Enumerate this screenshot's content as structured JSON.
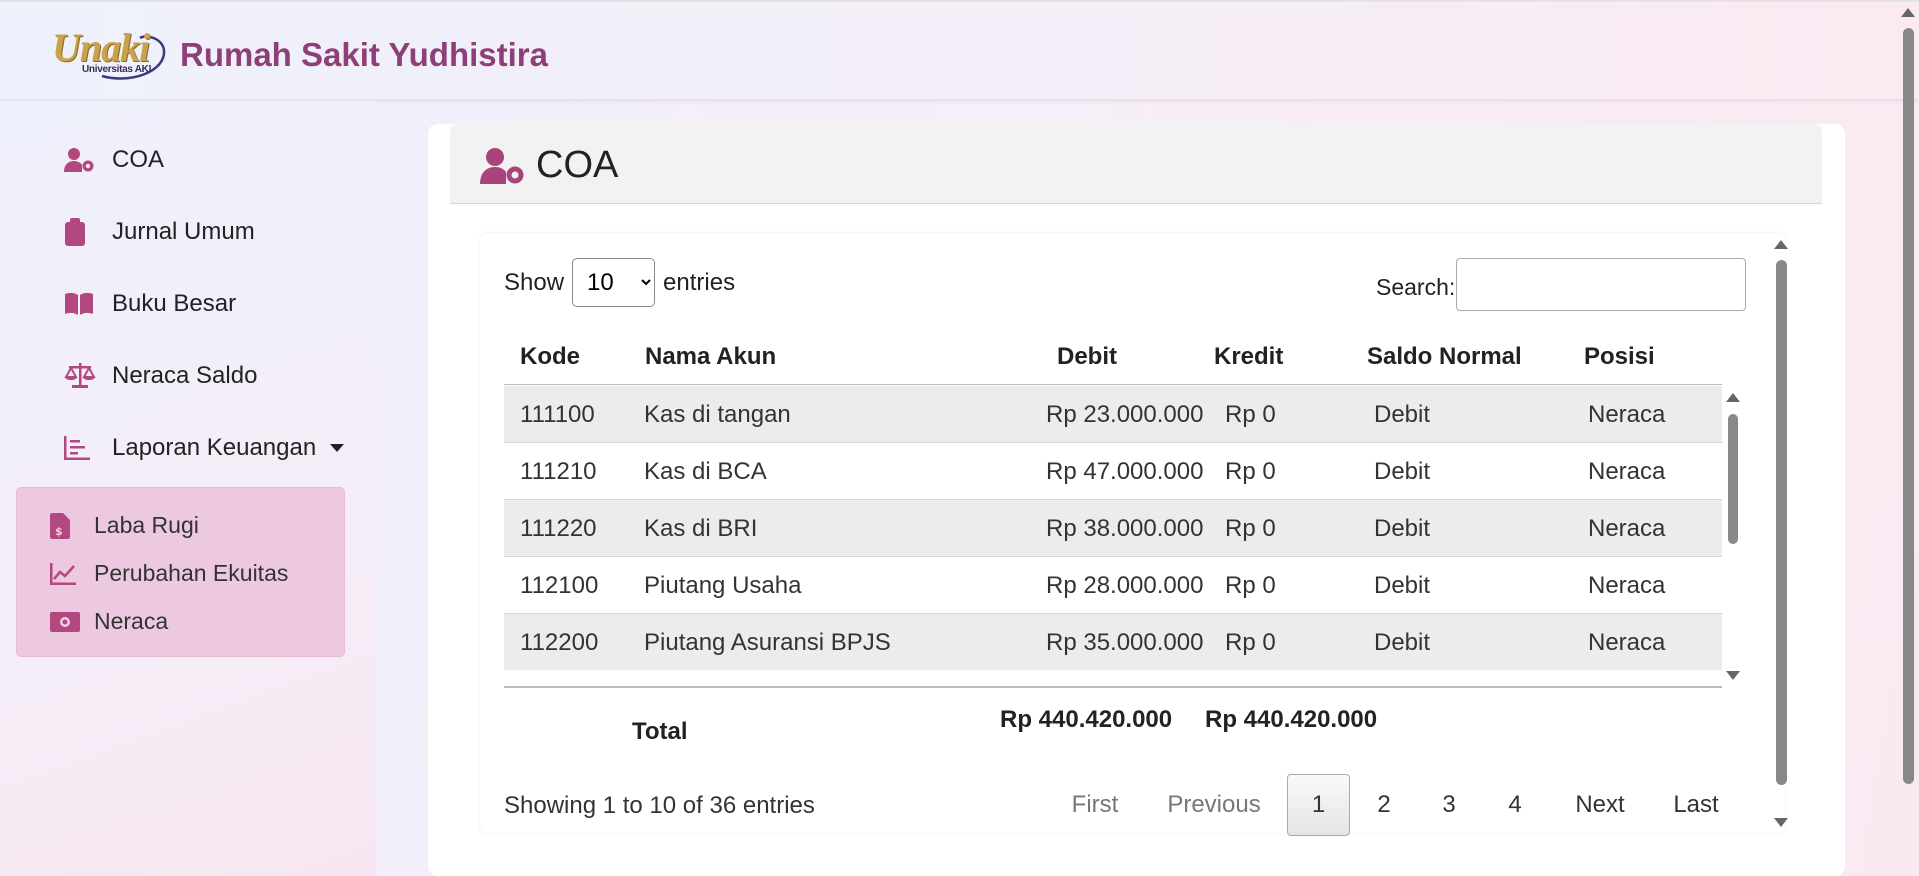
{
  "header": {
    "logo_text": "Unaki",
    "logo_subtext": "Universitas AKI",
    "app_title": "Rumah Sakit Yudhistira"
  },
  "sidebar": {
    "items": [
      {
        "label": "COA",
        "icon": "user-gear-icon"
      },
      {
        "label": "Jurnal Umum",
        "icon": "clipboard-icon"
      },
      {
        "label": "Buku Besar",
        "icon": "book-open-icon"
      },
      {
        "label": "Neraca Saldo",
        "icon": "scale-balanced-icon"
      },
      {
        "label": "Laporan Keuangan",
        "icon": "chart-bar-icon"
      }
    ],
    "submenu": [
      {
        "label": "Laba Rugi",
        "icon": "file-invoice-dollar-icon"
      },
      {
        "label": "Perubahan Ekuitas",
        "icon": "chart-line-icon"
      },
      {
        "label": "Neraca",
        "icon": "money-bill-icon"
      }
    ]
  },
  "page": {
    "title": "COA",
    "title_icon": "user-gear-icon"
  },
  "table_controls": {
    "show_label": "Show",
    "entries_value": "10",
    "entries_options": [
      "10"
    ],
    "entries_label": "entries",
    "search_label": "Search:",
    "search_value": ""
  },
  "table": {
    "columns": [
      "Kode",
      "Nama Akun",
      "Debit",
      "Kredit",
      "Saldo Normal",
      "Posisi"
    ],
    "rows": [
      [
        "111100",
        "Kas di tangan",
        "Rp 23.000.000",
        "Rp 0",
        "Debit",
        "Neraca"
      ],
      [
        "111210",
        "Kas di BCA",
        "Rp 47.000.000",
        "Rp 0",
        "Debit",
        "Neraca"
      ],
      [
        "111220",
        "Kas di BRI",
        "Rp 38.000.000",
        "Rp 0",
        "Debit",
        "Neraca"
      ],
      [
        "112100",
        "Piutang Usaha",
        "Rp 28.000.000",
        "Rp 0",
        "Debit",
        "Neraca"
      ],
      [
        "112200",
        "Piutang Asuransi BPJS",
        "Rp 35.000.000",
        "Rp 0",
        "Debit",
        "Neraca"
      ]
    ],
    "footer": {
      "label": "Total",
      "debit": "Rp 440.420.000",
      "kredit": "Rp 440.420.000"
    }
  },
  "pagination": {
    "info": "Showing 1 to 10 of 36 entries",
    "first": "First",
    "previous": "Previous",
    "pages": [
      "1",
      "2",
      "3",
      "4"
    ],
    "current": "1",
    "next": "Next",
    "last": "Last"
  },
  "colors": {
    "brand": "#8e3f78",
    "icon": "#b2487f",
    "submenu_bg": "#ecc9de"
  }
}
